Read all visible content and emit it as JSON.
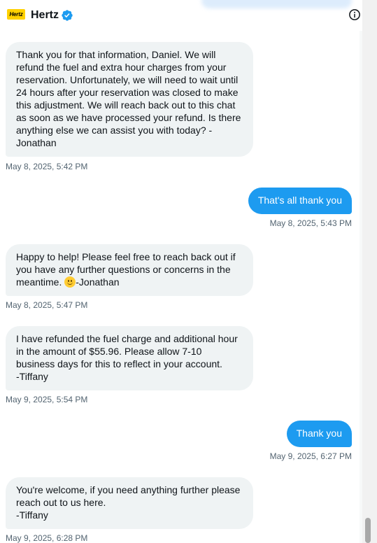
{
  "header": {
    "logo_text": "Hertz",
    "name": "Hertz",
    "verified_icon": "verified-badge-icon",
    "info_icon": "info-icon"
  },
  "colors": {
    "incoming_bubble": "#eff3f4",
    "outgoing_bubble": "#1d9bf0",
    "timestamp": "#536471",
    "logo_yellow": "#ffd100"
  },
  "messages": [
    {
      "direction": "in",
      "text": "Thank you for that information, Daniel. We will refund the fuel and extra hour charges from your reservation. Unfortunately, we will need to wait until 24 hours after your reservation was closed to make this adjustment. We will reach back out to this chat as soon as we have processed your refund. Is there anything else we can assist you with today? -Jonathan",
      "timestamp": "May 8, 2025, 5:42 PM"
    },
    {
      "direction": "out",
      "text": "That's all thank you",
      "timestamp": "May 8, 2025, 5:43 PM"
    },
    {
      "direction": "in",
      "text_before_emoji": "Happy to help! Please feel free to reach back out if you have any further questions or concerns in the meantime. ",
      "emoji": "slightly-smiling-face-icon",
      "text_after_emoji": "-Jonathan",
      "timestamp": "May 8, 2025, 5:47 PM"
    },
    {
      "direction": "in",
      "text": "I have refunded the fuel charge and additional hour in the amount of $55.96. Please allow 7-10 business days for this to reflect in your account.\n-Tiffany",
      "timestamp": "May 9, 2025, 5:54 PM"
    },
    {
      "direction": "out",
      "text": "Thank you",
      "timestamp": "May 9, 2025, 6:27 PM"
    },
    {
      "direction": "in",
      "text": "You're welcome, if you need anything further please reach out to us here.\n-Tiffany",
      "timestamp": "May 9, 2025, 6:28 PM"
    }
  ]
}
